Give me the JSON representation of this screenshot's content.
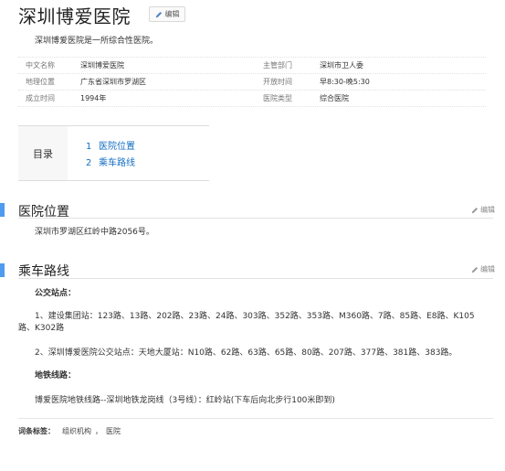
{
  "page_title": "深圳博爱医院",
  "edit_label": "编辑",
  "summary": "深圳博爱医院是一所综合性医院。",
  "basic_info": {
    "left": [
      {
        "label": "中文名称",
        "value": "深圳博爱医院"
      },
      {
        "label": "地理位置",
        "value": "广东省深圳市罗湖区"
      },
      {
        "label": "成立时间",
        "value": "1994年"
      }
    ],
    "right": [
      {
        "label": "主管部门",
        "value": "深圳市卫人委"
      },
      {
        "label": "开放时间",
        "value": "早8:30-晚5:30"
      },
      {
        "label": "医院类型",
        "value": "综合医院"
      }
    ]
  },
  "toc": {
    "heading": "目录",
    "items": [
      {
        "num": "1",
        "label": "医院位置"
      },
      {
        "num": "2",
        "label": "乘车路线"
      }
    ]
  },
  "sections": {
    "location": {
      "title": "医院位置",
      "edit": "编辑",
      "text": "深圳市罗湖区红岭中路2056号。"
    },
    "transport": {
      "title": "乘车路线",
      "edit": "编辑",
      "bus_heading": "公交站点：",
      "bus_1": "1、建设集团站：123路、13路、202路、23路、24路、303路、352路、353路、M360路、7路、85路、E8路、K105路、K302路",
      "bus_2": "2、深圳博爱医院公交站点：天地大厦站：N10路、62路、63路、65路、80路、207路、377路、381路、383路。",
      "metro_heading": "地铁线路：",
      "metro_text": "博爱医院地铁线路--深圳地铁龙岗线（3号线）：红岭站(下车后向北步行100米即到)"
    }
  },
  "tags": {
    "label": "词条标签：",
    "items": [
      "组织机构",
      "医院"
    ]
  },
  "colors": {
    "accent": "#4f9cee",
    "link": "#136ec2"
  }
}
